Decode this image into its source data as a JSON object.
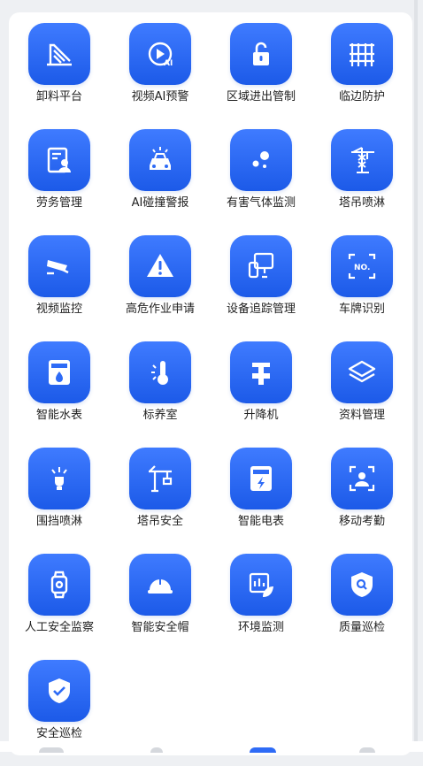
{
  "grid": {
    "items": [
      {
        "label": "卸料平台",
        "icon": "unloading-platform-icon"
      },
      {
        "label": "视频AI预警",
        "icon": "video-ai-icon"
      },
      {
        "label": "区域进出管制",
        "icon": "unlock-icon"
      },
      {
        "label": "临边防护",
        "icon": "fence-icon"
      },
      {
        "label": "劳务管理",
        "icon": "worker-card-icon"
      },
      {
        "label": "AI碰撞警报",
        "icon": "car-alarm-icon"
      },
      {
        "label": "有害气体监测",
        "icon": "gas-icon"
      },
      {
        "label": "塔吊喷淋",
        "icon": "crane-spray-icon"
      },
      {
        "label": "视频监控",
        "icon": "cctv-camera-icon"
      },
      {
        "label": "高危作业申请",
        "icon": "warning-icon"
      },
      {
        "label": "设备追踪管理",
        "icon": "device-tracking-icon"
      },
      {
        "label": "车牌识别",
        "icon": "plate-scan-icon"
      },
      {
        "label": "智能水表",
        "icon": "water-meter-icon"
      },
      {
        "label": "标养室",
        "icon": "thermometer-icon"
      },
      {
        "label": "升降机",
        "icon": "hoist-icon"
      },
      {
        "label": "资料管理",
        "icon": "layers-icon"
      },
      {
        "label": "围挡喷淋",
        "icon": "sprinkler-icon"
      },
      {
        "label": "塔吊安全",
        "icon": "tower-crane-icon"
      },
      {
        "label": "智能电表",
        "icon": "electric-meter-icon"
      },
      {
        "label": "移动考勤",
        "icon": "face-scan-icon"
      },
      {
        "label": "人工安全监察",
        "icon": "watch-icon"
      },
      {
        "label": "智能安全帽",
        "icon": "helmet-icon"
      },
      {
        "label": "环境监测",
        "icon": "environment-leaf-icon"
      },
      {
        "label": "质量巡检",
        "icon": "quality-shield-icon"
      },
      {
        "label": "安全巡检",
        "icon": "safety-shield-check-icon"
      }
    ]
  },
  "colors": {
    "icon_gradient_top": "#3f7bff",
    "icon_gradient_bottom": "#1c5ae8",
    "label": "#222222",
    "background": "#eef0f3"
  }
}
